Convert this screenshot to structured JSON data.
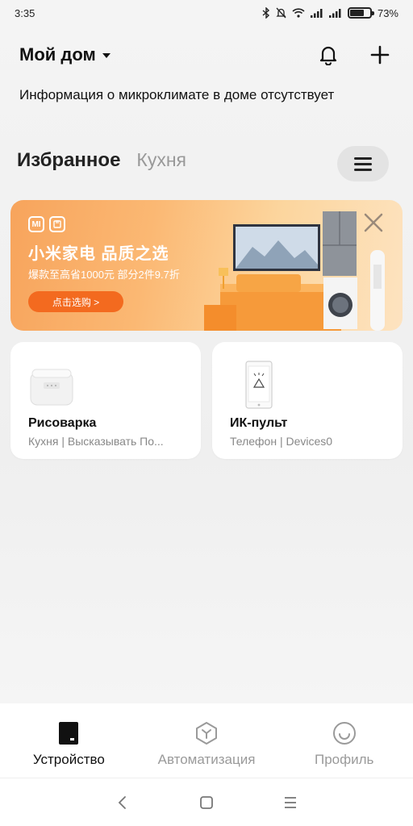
{
  "status_bar": {
    "time": "3:35",
    "battery_text": "73%",
    "battery_level": 0.73
  },
  "header": {
    "home_title": "Мой дом",
    "climate_info": "Информация о микроклимате в доме отсутствует"
  },
  "tabs": [
    {
      "label": "Избранное",
      "active": true
    },
    {
      "label": "Кухня",
      "active": false
    }
  ],
  "banner": {
    "logo_text": "MI",
    "title": "小米家电 品质之选",
    "subtitle": "爆款至高省1000元 部分2件9.7折",
    "cta": "点击选购 >"
  },
  "devices": [
    {
      "name": "Рисоварка",
      "subtitle": "Кухня | Высказывать По...",
      "icon": "rice-cooker"
    },
    {
      "name": "ИК-пульт",
      "subtitle": "Телефон | Devices0",
      "icon": "phone-ir-remote"
    }
  ],
  "bottom_tabs": [
    {
      "label": "Устройство",
      "icon": "device-icon",
      "active": true
    },
    {
      "label": "Автоматизация",
      "icon": "automation-icon",
      "active": false
    },
    {
      "label": "Профиль",
      "icon": "profile-icon",
      "active": false
    }
  ],
  "colors": {
    "accent_orange": "#f36a1f",
    "active_text": "#111111",
    "inactive_text": "#9a9a9a"
  }
}
